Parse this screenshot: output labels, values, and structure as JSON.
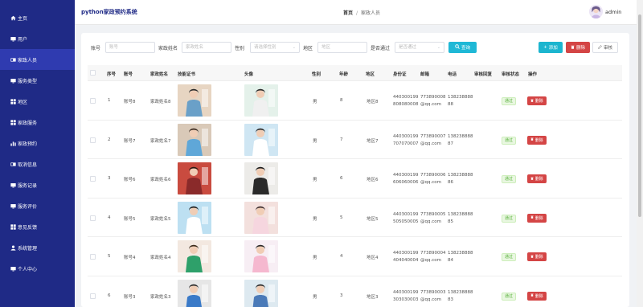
{
  "sidebar": {
    "items": [
      {
        "label": "主页",
        "icon": "home-icon"
      },
      {
        "label": "用户",
        "icon": "monitor-icon"
      },
      {
        "label": "家政人员",
        "icon": "id-card-icon"
      },
      {
        "label": "服务类型",
        "icon": "monitor-icon"
      },
      {
        "label": "地区",
        "icon": "grid-icon"
      },
      {
        "label": "家政服务",
        "icon": "grid-icon"
      },
      {
        "label": "家政预约",
        "icon": "bar-chart-icon"
      },
      {
        "label": "取消信息",
        "icon": "id-card-icon"
      },
      {
        "label": "服务记录",
        "icon": "monitor-icon"
      },
      {
        "label": "服务评价",
        "icon": "monitor-icon"
      },
      {
        "label": "意见反馈",
        "icon": "grid-icon"
      },
      {
        "label": "系统管理",
        "icon": "user-icon"
      },
      {
        "label": "个人中心",
        "icon": "monitor-icon"
      }
    ],
    "active_index": 2
  },
  "header": {
    "title": "python家政预约系统",
    "breadcrumb_home": "首页",
    "breadcrumb_sep": "/",
    "breadcrumb_current": "家政人员",
    "user": "admin"
  },
  "search": {
    "account_label": "账号",
    "account_placeholder": "账号",
    "name_label": "家政姓名",
    "name_placeholder": "家政姓名",
    "gender_label": "性别",
    "gender_placeholder": "请选择性别",
    "region_label": "地区",
    "region_placeholder": "地区",
    "approved_label": "是否通过",
    "approved_placeholder": "是否通过",
    "search_button": "查询"
  },
  "toolbar": {
    "add": "添加",
    "delete": "删除",
    "audit": "审核"
  },
  "table": {
    "headers": {
      "index": "序号",
      "account": "账号",
      "name": "家政姓名",
      "cert": "技能证书",
      "avatar": "头像",
      "gender": "性别",
      "age": "年龄",
      "region": "地区",
      "idcard": "身份证",
      "email": "邮箱",
      "phone": "电话",
      "reply": "审核回复",
      "status": "审核状态",
      "actions": "操作"
    },
    "rows": [
      {
        "index": "1",
        "account": "账号8",
        "name": "家政姓名8",
        "gender": "男",
        "age": "8",
        "region": "地区8",
        "id1": "440300199",
        "id2": "808080008",
        "mail1": "773890008",
        "mail2": "@qq.com",
        "ph1": "138238888",
        "ph2": "88",
        "status": "通过",
        "del": "删除"
      },
      {
        "index": "2",
        "account": "账号7",
        "name": "家政姓名7",
        "gender": "男",
        "age": "7",
        "region": "地区7",
        "id1": "440300199",
        "id2": "707070007",
        "mail1": "773890007",
        "mail2": "@qq.com",
        "ph1": "138238888",
        "ph2": "87",
        "status": "通过",
        "del": "删除"
      },
      {
        "index": "3",
        "account": "账号6",
        "name": "家政姓名6",
        "gender": "男",
        "age": "6",
        "region": "地区6",
        "id1": "440300199",
        "id2": "606060006",
        "mail1": "773890006",
        "mail2": "@qq.com",
        "ph1": "138238888",
        "ph2": "86",
        "status": "通过",
        "del": "删除"
      },
      {
        "index": "4",
        "account": "账号5",
        "name": "家政姓名5",
        "gender": "男",
        "age": "5",
        "region": "地区5",
        "id1": "440300199",
        "id2": "505050005",
        "mail1": "773890005",
        "mail2": "@qq.com",
        "ph1": "138238888",
        "ph2": "85",
        "status": "通过",
        "del": "删除"
      },
      {
        "index": "5",
        "account": "账号4",
        "name": "家政姓名4",
        "gender": "男",
        "age": "4",
        "region": "地区4",
        "id1": "440300199",
        "id2": "404040004",
        "mail1": "773890004",
        "mail2": "@qq.com",
        "ph1": "138238888",
        "ph2": "84",
        "status": "通过",
        "del": "删除"
      },
      {
        "index": "6",
        "account": "账号3",
        "name": "家政姓名3",
        "gender": "男",
        "age": "3",
        "region": "地区3",
        "id1": "440300199",
        "id2": "303030003",
        "mail1": "773890003",
        "mail2": "@qq.com",
        "ph1": "138238888",
        "ph2": "83",
        "status": "通过",
        "del": "删除"
      }
    ]
  },
  "colors": {
    "sidebar": "#1f2a86",
    "active": "#2f3bb0",
    "primary": "#1fb8d6",
    "danger": "#d44545",
    "success": "#58b13b"
  }
}
